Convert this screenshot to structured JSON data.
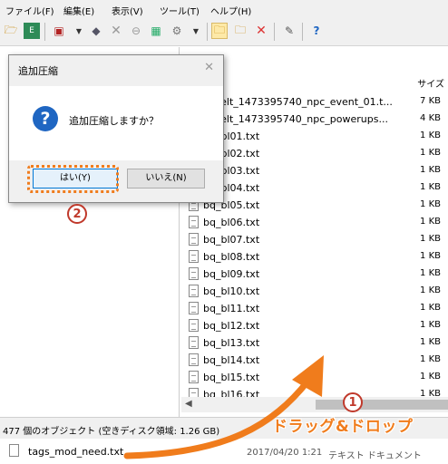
{
  "menu": [
    "ファイル(F)",
    "編集(E)",
    "表示(V)",
    "ツール(T)",
    "ヘルプ(H)"
  ],
  "header": {
    "size_col": "サイズ"
  },
  "files": [
    {
      "name": "ciblelt_1473395740_npc_event_01.t...",
      "size": "7 KB"
    },
    {
      "name": "ciblelt_1473395740_npc_powerups...",
      "size": "4 KB"
    },
    {
      "name": "bq_bl01.txt",
      "size": "1 KB"
    },
    {
      "name": "bq_bl02.txt",
      "size": "1 KB"
    },
    {
      "name": "bq_bl03.txt",
      "size": "1 KB"
    },
    {
      "name": "bq_bl04.txt",
      "size": "1 KB"
    },
    {
      "name": "bq_bl05.txt",
      "size": "1 KB"
    },
    {
      "name": "bq_bl06.txt",
      "size": "1 KB"
    },
    {
      "name": "bq_bl07.txt",
      "size": "1 KB"
    },
    {
      "name": "bq_bl08.txt",
      "size": "1 KB"
    },
    {
      "name": "bq_bl09.txt",
      "size": "1 KB"
    },
    {
      "name": "bq_bl10.txt",
      "size": "1 KB"
    },
    {
      "name": "bq_bl11.txt",
      "size": "1 KB"
    },
    {
      "name": "bq_bl12.txt",
      "size": "1 KB"
    },
    {
      "name": "bq_bl13.txt",
      "size": "1 KB"
    },
    {
      "name": "bq_bl14.txt",
      "size": "1 KB"
    },
    {
      "name": "bq_bl15.txt",
      "size": "1 KB"
    },
    {
      "name": "bq_bl16.txt",
      "size": "1 KB"
    }
  ],
  "dialog": {
    "title": "追加圧縮",
    "close": "✕",
    "icon": "?",
    "message": "追加圧縮しますか？",
    "yes_label": "はい(Y)",
    "no_label": "いいえ(N)"
  },
  "status": {
    "text": "477 個のオブジェクト (空きディスク領域: 1.26 GB)"
  },
  "dragged_file": {
    "name": "tags_mod_need.txt",
    "date": "2017/04/20 1:21",
    "type": "テキスト ドキュメント"
  },
  "annotations": {
    "step1": "1",
    "step2": "2",
    "drag_label": "ドラッグ&ドロップ"
  },
  "colors": {
    "accent": "#f07c1c",
    "badge": "#c0392b",
    "dialog_icon": "#1f66c2"
  },
  "icons": [
    "open-icon",
    "extract-icon",
    "add-icon",
    "delete-icon",
    "view-icon",
    "properties-icon",
    "folder-open-icon",
    "folder-icon",
    "cancel-icon",
    "tools-icon",
    "help-icon",
    "question-icon",
    "file-icon"
  ]
}
